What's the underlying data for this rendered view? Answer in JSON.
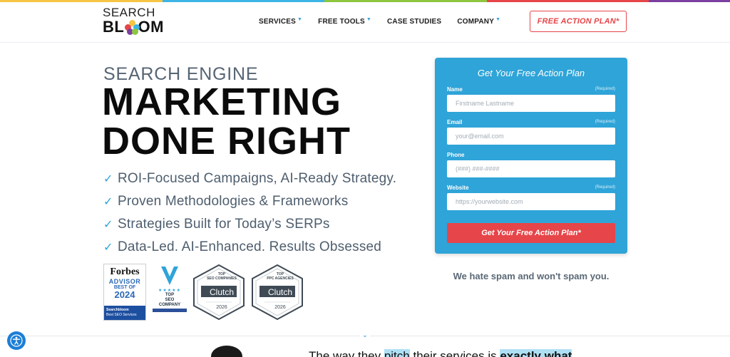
{
  "brand": {
    "logo_top": "SEARCH",
    "logo_bottom_left": "BL",
    "logo_bottom_right": "OM",
    "rainbow_colors": [
      "#f6c544",
      "#f6c544",
      "#3cb4e5",
      "#3cb4e5",
      "#8dc63f",
      "#8dc63f",
      "#e64549",
      "#e64549",
      "#7b3fa0"
    ]
  },
  "nav": {
    "items": [
      {
        "label": "SERVICES",
        "has_caret": true
      },
      {
        "label": "FREE TOOLS",
        "has_caret": true
      },
      {
        "label": "CASE STUDIES",
        "has_caret": false
      },
      {
        "label": "COMPANY",
        "has_caret": true
      }
    ],
    "cta": "FREE ACTION PLAN*"
  },
  "hero": {
    "subtitle": "SEARCH ENGINE",
    "title_line1": "MARKETING",
    "title_line2": "DONE RIGHT",
    "checks": [
      "ROI-Focused Campaigns, AI-Ready Strategy.",
      "Proven Methodologies & Frameworks",
      "Strategies Built for Today’s SERPs",
      "Data-Led. AI-Enhanced. Results Obsessed"
    ]
  },
  "badges": {
    "forbes": {
      "name": "Forbes",
      "advisor": "ADVISOR",
      "best_of": "BEST OF",
      "year": "2024",
      "footer_1": "Searchbloom",
      "footer_2": "Best SEO Services"
    },
    "designrush": {
      "line1": "TOP",
      "line2": "SEO",
      "line3": "COMPANY"
    },
    "clutch": [
      {
        "top": "TOP",
        "category": "SEO COMPANIES",
        "name": "Clutch",
        "year": "2026"
      },
      {
        "top": "TOP",
        "category": "PPC AGENCIES",
        "name": "Clutch",
        "year": "2026"
      }
    ]
  },
  "form": {
    "title": "Get Your Free Action Plan",
    "fields": [
      {
        "label": "Name",
        "required": "(Required)",
        "placeholder": "Firstname Lastname"
      },
      {
        "label": "Email",
        "required": "(Required)",
        "placeholder": "your@email.com"
      },
      {
        "label": "Phone",
        "required": "",
        "placeholder": "(###) ###-####"
      },
      {
        "label": "Website",
        "required": "(Required)",
        "placeholder": "https://yourwebsite.com"
      }
    ],
    "submit": "Get Your Free Action Plan*"
  },
  "nospam": "We hate spam and won't spam you.",
  "bottom": {
    "part1": "The way they ",
    "part2": "pitch",
    "part3": " their services is ",
    "part4": "exactly what"
  },
  "colors": {
    "accent_blue": "#2fa4d8",
    "accent_red": "#e64549",
    "text_gray": "#4e5e6e"
  }
}
